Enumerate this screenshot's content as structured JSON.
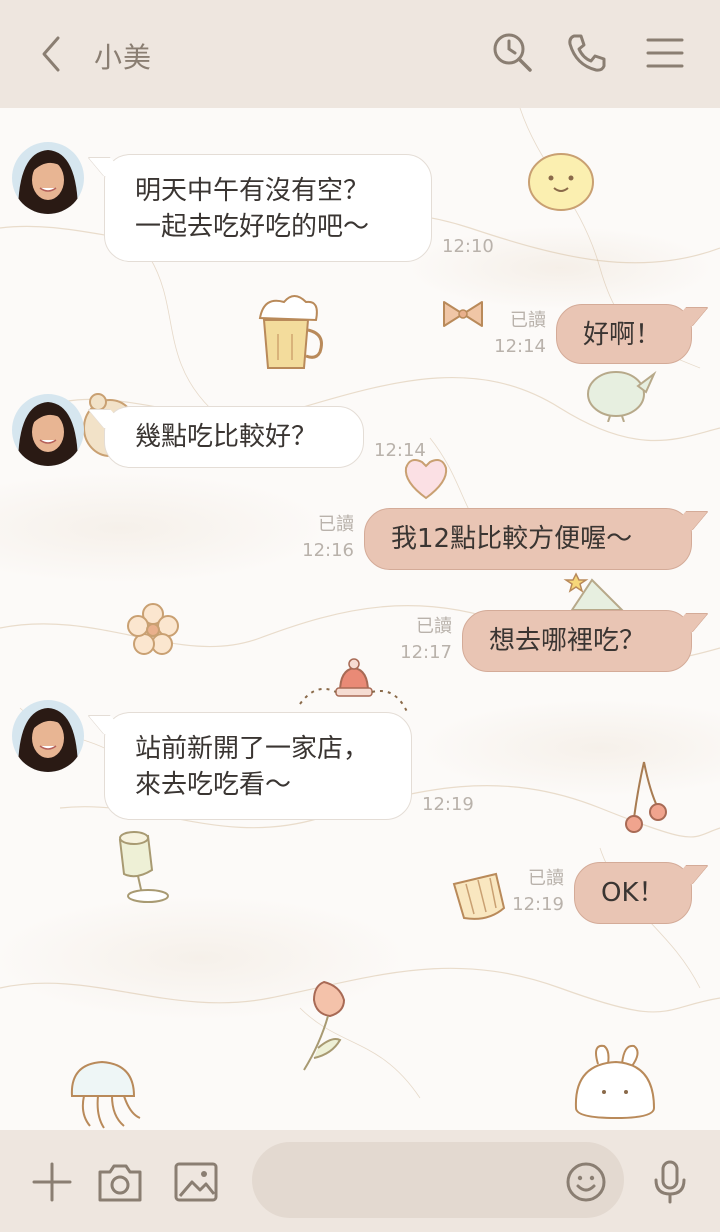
{
  "header": {
    "title": "小美",
    "icons": [
      "chevron-left-icon",
      "search-icon",
      "phone-icon",
      "menu-icon"
    ]
  },
  "messages": [
    {
      "side": "in",
      "text": "明天中午有沒有空？\n一起去吃好吃的吧～",
      "time": "12:10"
    },
    {
      "side": "out",
      "text": "好啊！",
      "read": "已讀",
      "time": "12:14"
    },
    {
      "side": "in",
      "text": "幾點吃比較好？",
      "time": "12:14"
    },
    {
      "side": "out",
      "text": "我12點比較方便喔～",
      "read": "已讀",
      "time": "12:16"
    },
    {
      "side": "out",
      "text": "想去哪裡吃？",
      "read": "已讀",
      "time": "12:17"
    },
    {
      "side": "in",
      "text": "站前新開了一家店，\n來去吃吃看～",
      "time": "12:19"
    },
    {
      "side": "out",
      "text": "OK！",
      "read": "已讀",
      "time": "12:19"
    }
  ],
  "footer": {
    "input_value": "",
    "input_placeholder": "",
    "icons": [
      "plus-icon",
      "camera-icon",
      "image-icon",
      "emoji-icon",
      "microphone-icon"
    ]
  },
  "colors": {
    "header_bg": "#eee6df",
    "outgoing_bubble": "#e9c5b4",
    "incoming_bubble": "#ffffff",
    "meta_text": "#b9b2ab",
    "icon": "#8a7e72"
  }
}
